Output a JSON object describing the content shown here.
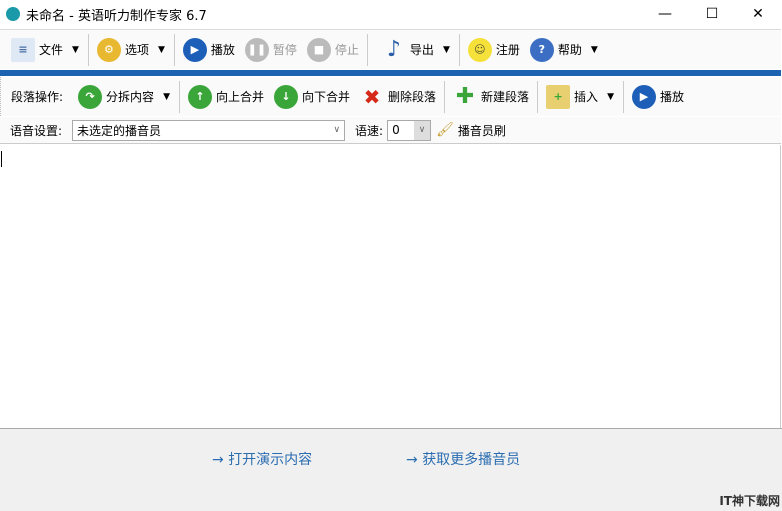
{
  "window": {
    "title": "未命名 - 英语听力制作专家 6.7",
    "minimize": "—",
    "maximize": "☐",
    "close": "✕"
  },
  "toolbar": {
    "file": "文件",
    "options": "选项",
    "play": "播放",
    "pause": "暂停",
    "stop": "停止",
    "export": "导出",
    "register": "注册",
    "help": "帮助"
  },
  "paragraph": {
    "label": "段落操作:",
    "split": "分拆内容",
    "merge_up": "向上合并",
    "merge_down": "向下合并",
    "delete": "删除段落",
    "new": "新建段落",
    "insert": "插入",
    "play": "播放"
  },
  "voice": {
    "label": "语音设置:",
    "speaker": "未选定的播音员",
    "speed_label": "语速:",
    "speed": "0",
    "brush": "播音员刷"
  },
  "bottom": {
    "open_demo": "打开演示内容",
    "more_speakers": "获取更多播音员",
    "watermark": "IT神下载网"
  }
}
